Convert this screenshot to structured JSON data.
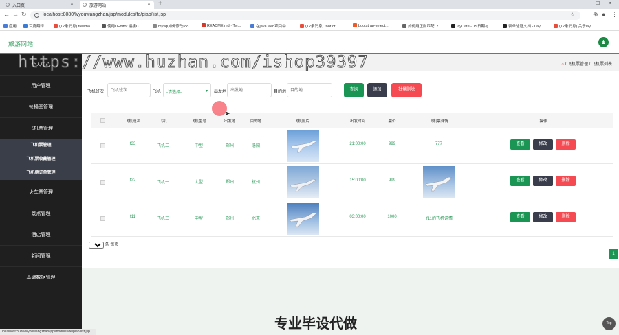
{
  "browser": {
    "tabs": [
      {
        "label": "入口页",
        "active": false
      },
      {
        "label": "旅游网站",
        "active": true
      }
    ],
    "url": "localhost:8080/lvyouwangzhan/jsp/modules/fe/piao/list.jsp",
    "bookmarks": [
      "应用",
      "百度翻译",
      "(12条消息) freema...",
      "使用UEditor 接接C...",
      "mysql如何修改roo...",
      "README.md · Ter...",
      "在java web项目中...",
      "(12条消息) root of...",
      "bootstrap-select...",
      "如何用正则匹配: Z...",
      "layDate - JS日期与...",
      "表单验证文档 - Lay...",
      "(12条消息) 关于lay..."
    ],
    "status_url": "localhost:8080/lvyouwangzhan/jsp/modules/fe/piao/list.jsp"
  },
  "app": {
    "brand": "旅游网站",
    "avatar_glyph": "♟",
    "accent": "#2e9b5c"
  },
  "sidebar": {
    "items": [
      {
        "label": "个人中心"
      },
      {
        "label": "用户管理"
      },
      {
        "label": "轮播图管理"
      },
      {
        "label": "飞机票管理"
      },
      {
        "label": "火车票管理"
      },
      {
        "label": "景点管理"
      },
      {
        "label": "酒店管理"
      },
      {
        "label": "新闻管理"
      },
      {
        "label": "基础数据管理"
      }
    ],
    "submenu": [
      {
        "label": "飞机票管理"
      },
      {
        "label": "飞机票收藏管理"
      },
      {
        "label": "飞机票订单管理"
      }
    ]
  },
  "breadcrumb": {
    "home_icon": "⌂",
    "separator": "/",
    "level1": "飞机票管理",
    "level2": "飞机票列表"
  },
  "filters": {
    "flight_no_label": "飞机班次",
    "flight_no_placeholder": "飞机班次",
    "plane_label": "飞机",
    "plane_selected": "-请选择-",
    "departure_label": "出发地",
    "departure_placeholder": "出发地",
    "destination_label": "目的地",
    "destination_placeholder": "目的地",
    "search_button": "查询",
    "add_button": "添加",
    "batch_delete_button": "批量删除"
  },
  "table": {
    "headers": [
      "飞机班次",
      "飞机",
      "飞机型号",
      "出发地",
      "目的地",
      "飞机照片",
      "出发时间",
      "票价",
      "飞机票详情",
      "操作"
    ],
    "rows": [
      {
        "flight_no": "f33",
        "plane": "飞机二",
        "model": "中型",
        "from": "郑州",
        "to": "洛阳",
        "time": "21:00:00",
        "price": "999",
        "detail": "777",
        "detail_is_image": false
      },
      {
        "flight_no": "f22",
        "plane": "飞机一",
        "model": "大型",
        "from": "郑州",
        "to": "杭州",
        "time": "15:00:00",
        "price": "999",
        "detail": "",
        "detail_is_image": true
      },
      {
        "flight_no": "f11",
        "plane": "飞机三",
        "model": "中型",
        "from": "郑州",
        "to": "北京",
        "time": "03:00:00",
        "price": "1000",
        "detail": "f11的飞机详情",
        "detail_is_image": false
      }
    ],
    "row_actions": {
      "view": "查看",
      "edit": "修改",
      "delete": "删除"
    }
  },
  "pagination": {
    "page_size": "10",
    "page_size_suffix": "条 每页",
    "current_page": "1"
  },
  "promo": {
    "title": "专业毕设代做"
  },
  "top_button": "Top",
  "watermark": "https://www.huzhan.com/ishop39397"
}
